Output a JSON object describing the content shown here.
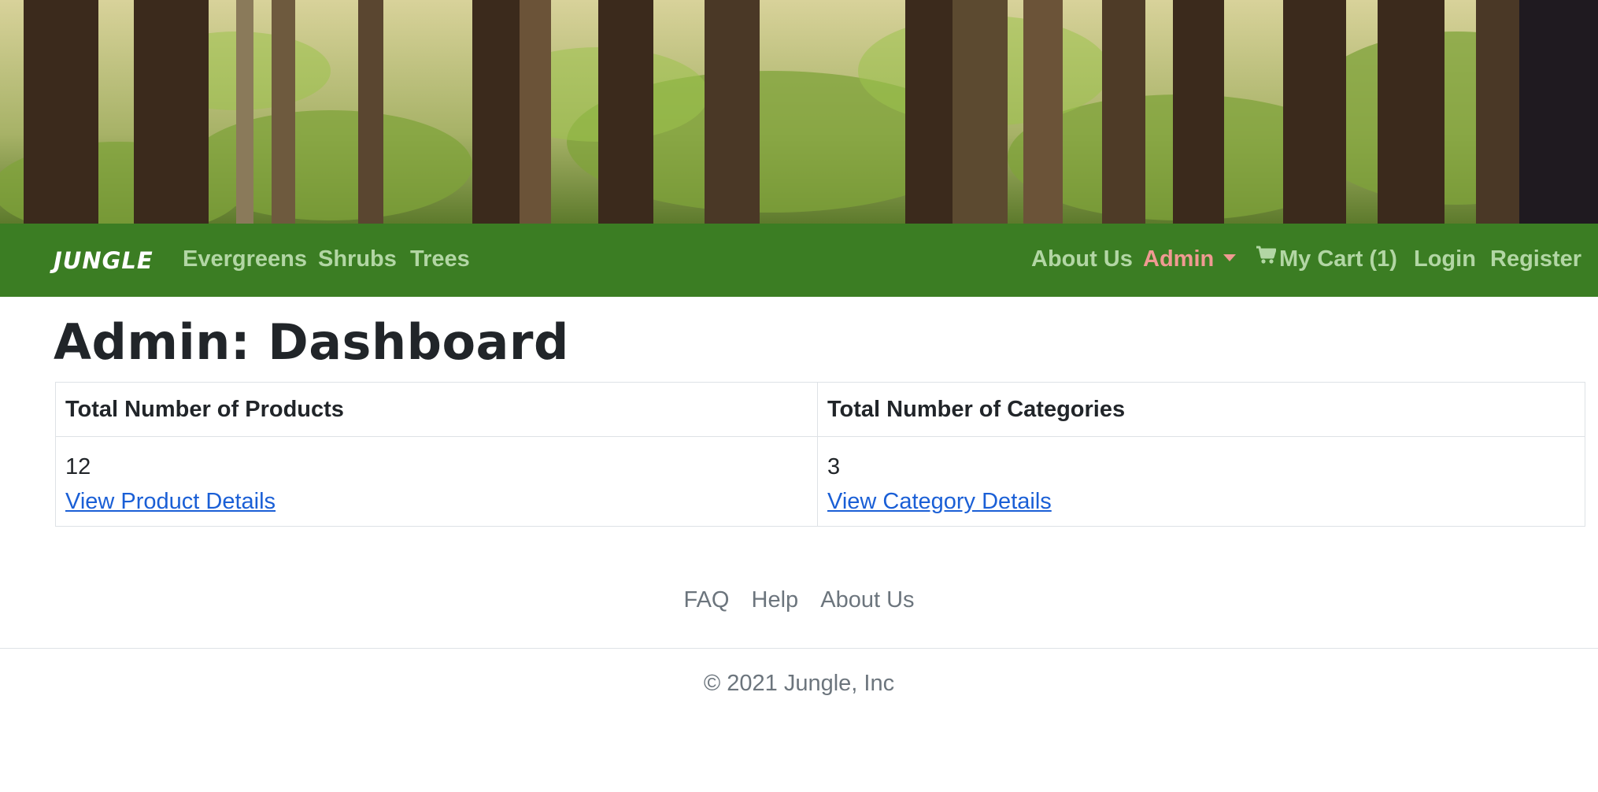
{
  "navbar": {
    "brand": "JUNGLE",
    "left_links": [
      "Evergreens",
      "Shrubs",
      "Trees"
    ],
    "about": "About Us",
    "admin": "Admin",
    "cart": "My Cart (1)",
    "login": "Login",
    "register": "Register",
    "bg_color": "#3b7d23",
    "link_color": "#b2d6a4",
    "admin_color": "#f09a92"
  },
  "main": {
    "title": "Admin: Dashboard",
    "table": {
      "headers": [
        "Total Number of Products",
        "Total Number of Categories"
      ],
      "products_count": "12",
      "products_link": "View Product Details",
      "categories_count": "3",
      "categories_link": "View Category Details"
    }
  },
  "footer": {
    "links": [
      "FAQ",
      "Help",
      "About Us"
    ],
    "copyright": "© 2021 Jungle, Inc"
  },
  "icons": {
    "cart": "shopping-cart-icon",
    "admin_dropdown": "caret-down-icon"
  }
}
